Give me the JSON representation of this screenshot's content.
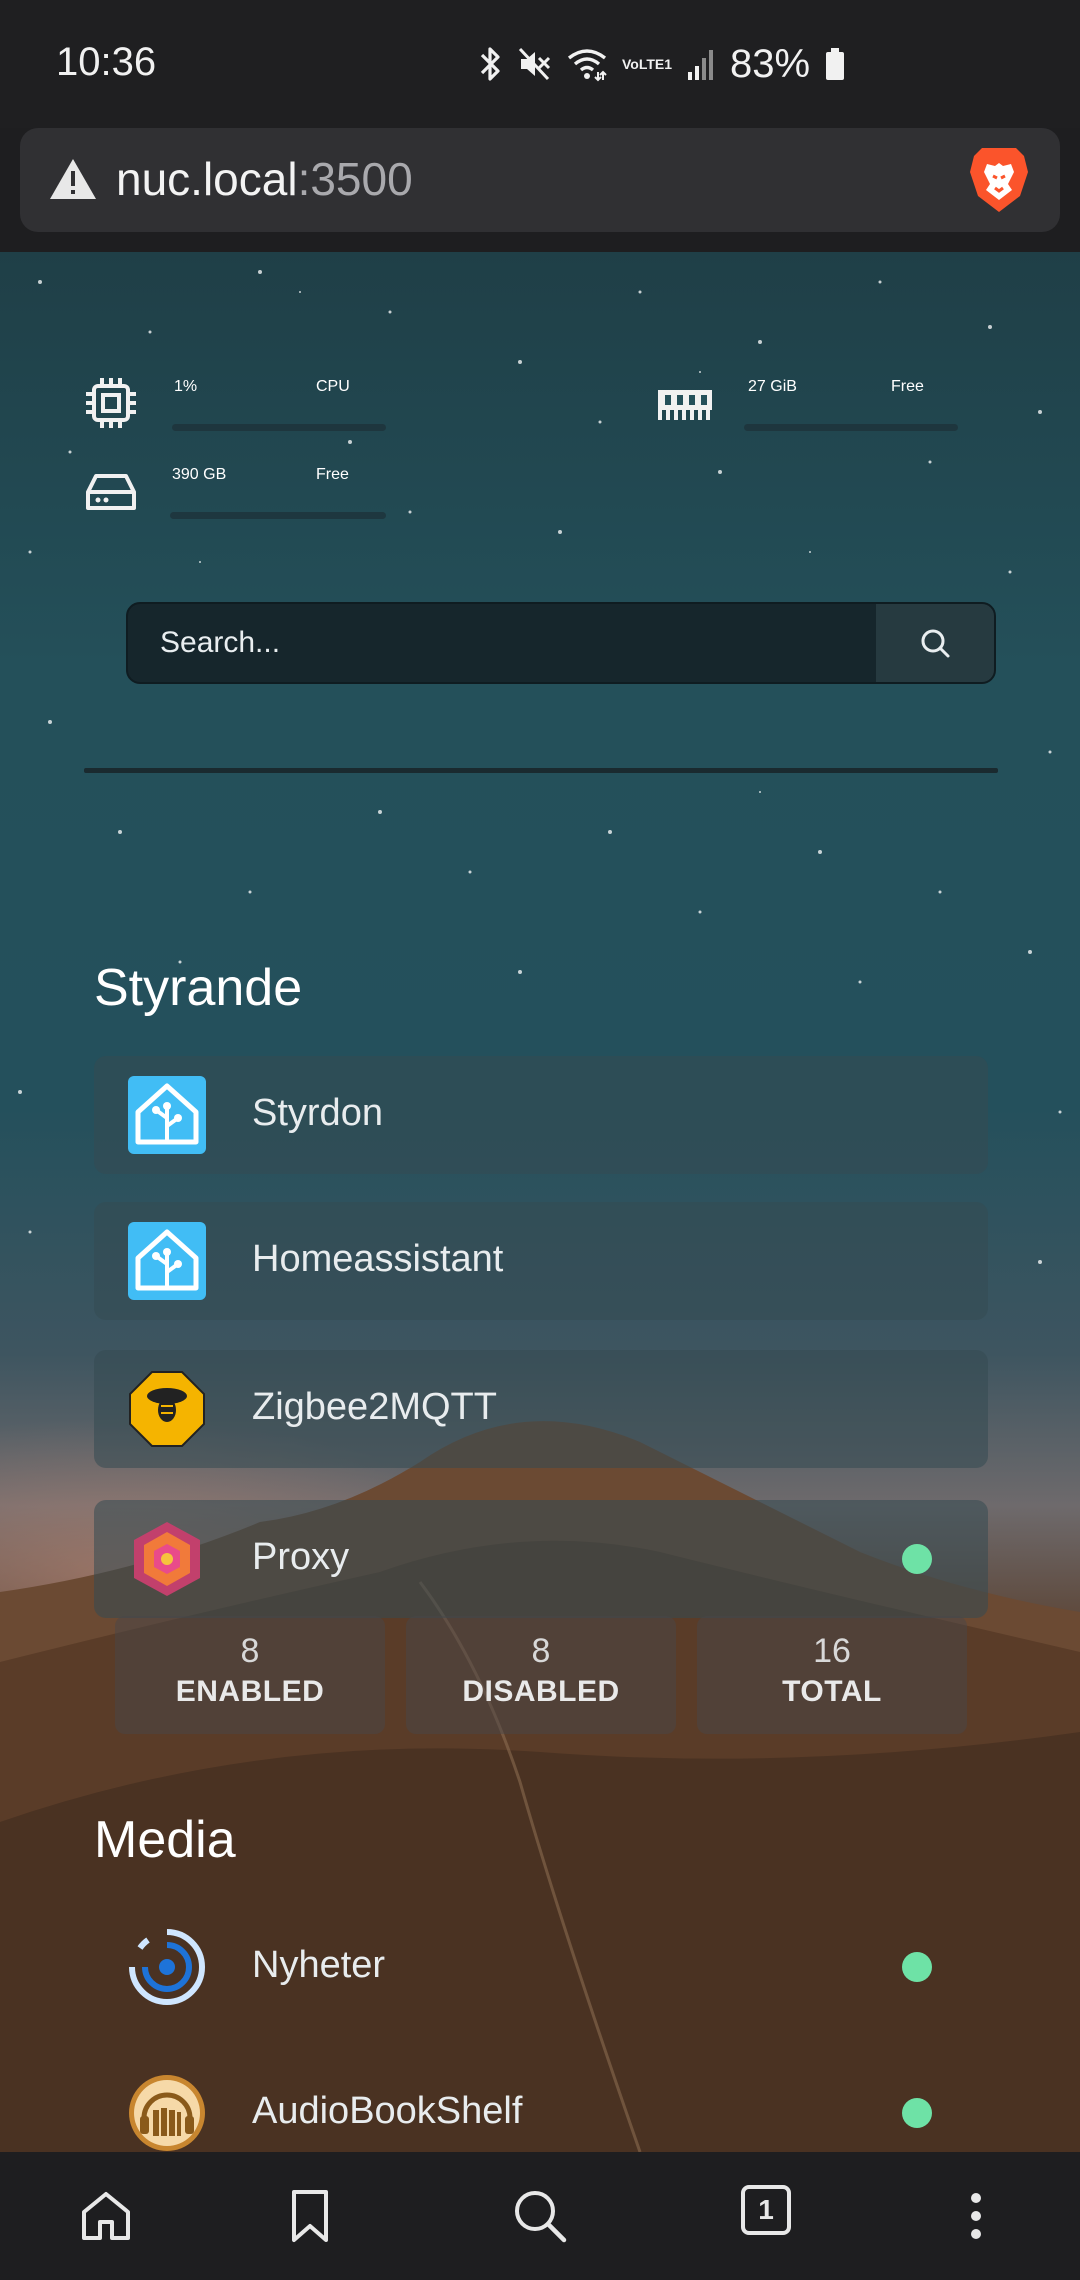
{
  "status_bar": {
    "time": "10:36",
    "battery": "83%",
    "network": "VoLTE1"
  },
  "browser": {
    "url_host": "nuc.local",
    "url_port": ":3500"
  },
  "stats": {
    "cpu_value": "1%",
    "cpu_label": "CPU",
    "ram_value": "27 GiB",
    "ram_label": "Free",
    "disk_value": "390 GB",
    "disk_label": "Free"
  },
  "search": {
    "placeholder": "Search..."
  },
  "sections": {
    "styrande": {
      "title": "Styrande",
      "apps": [
        {
          "name": "Styrdon"
        },
        {
          "name": "Homeassistant"
        },
        {
          "name": "Zigbee2MQTT"
        },
        {
          "name": "Proxy"
        }
      ]
    },
    "media": {
      "title": "Media",
      "apps": [
        {
          "name": "Nyheter"
        },
        {
          "name": "AudioBookShelf"
        }
      ]
    }
  },
  "counts": {
    "enabled": "8",
    "enabled_label": "ENABLED",
    "disabled": "8",
    "disabled_label": "DISABLED",
    "total": "16",
    "total_label": "TOTAL"
  },
  "colors": {
    "status_online": "#6ee2a6",
    "brave_orange": "#fb542b"
  },
  "nav": {
    "tab_count": "1"
  }
}
